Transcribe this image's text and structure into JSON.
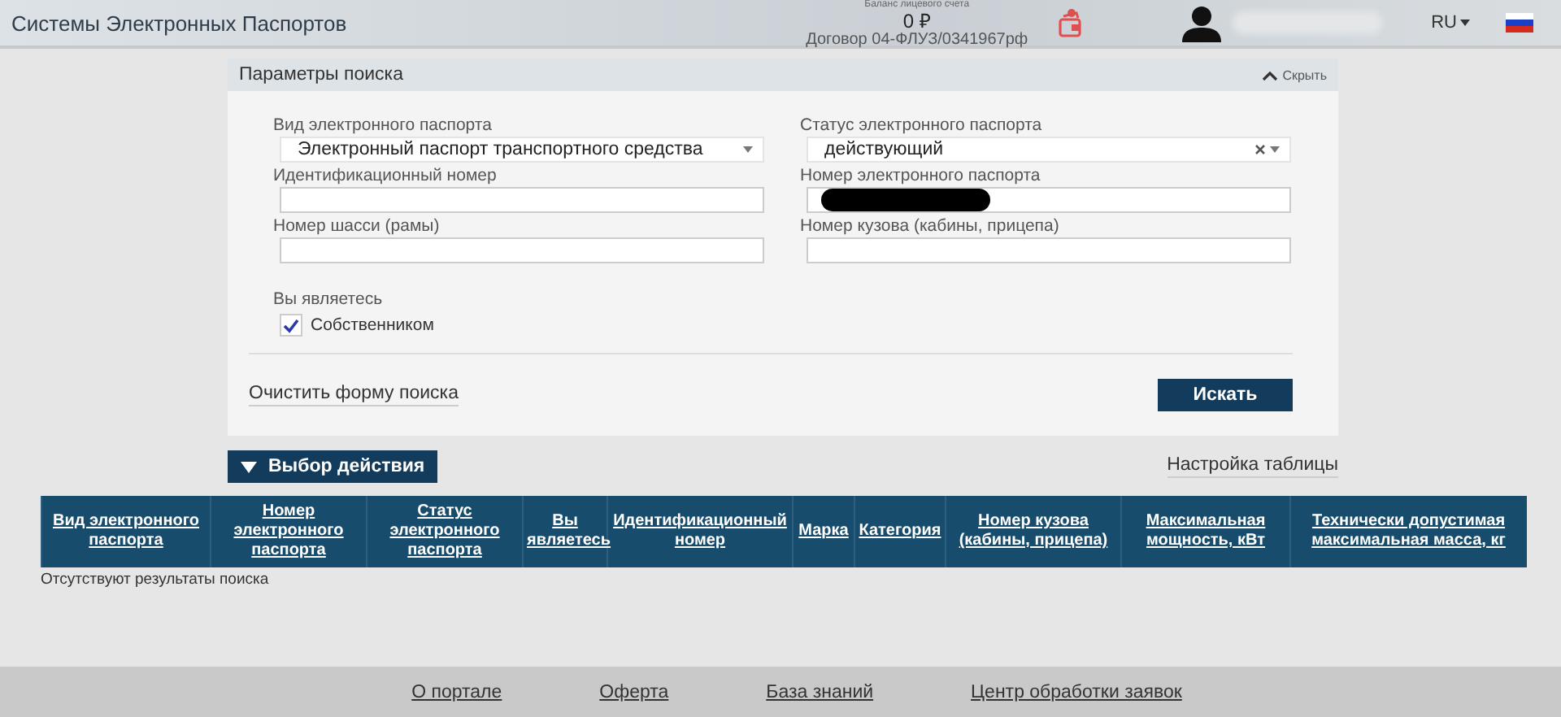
{
  "header": {
    "title": "Системы Электронных Паспортов",
    "balance_label": "Баланс лицевого счета",
    "balance": "0 ₽",
    "contract": "Договор 04-ФЛУЗ/0341967рф",
    "language": "RU"
  },
  "search_panel": {
    "title": "Параметры поиска",
    "collapse_label": "Скрыть",
    "fields": [
      {
        "kind": "select",
        "label": "Вид электронного паспорта",
        "value": "Электронный паспорт транспортного средства",
        "clearable": false
      },
      {
        "kind": "select",
        "label": "Статус электронного паспорта",
        "value": "действующий",
        "clearable": true
      },
      {
        "kind": "text",
        "label": "Идентификационный номер"
      },
      {
        "kind": "redacted",
        "label": "Номер электронного паспорта"
      },
      {
        "kind": "text",
        "label": "Номер шасси (рамы)"
      },
      {
        "kind": "text",
        "label": "Номер кузова (кабины, прицепа)"
      }
    ],
    "owner": {
      "label": "Вы являетесь",
      "option": "Собственником",
      "checked": true
    },
    "clear_link": "Очистить форму поиска",
    "search_button": "Искать"
  },
  "action_button": "Выбор действия",
  "table_settings": "Настройка таблицы",
  "table": {
    "columns": [
      "Вид электронного паспорта",
      "Номер электронного паспорта",
      "Статус электронного паспорта",
      "Вы являетесь",
      "Идентификационный номер",
      "Марка",
      "Категория",
      "Номер кузова (кабины, прицепа)",
      "Максимальная мощность, кВт",
      "Технически допустимая максимальная масса, кг"
    ],
    "empty_message": "Отсутствуют результаты поиска"
  },
  "footer": {
    "links": [
      "О портале",
      "Оферта",
      "База знаний",
      "Центр обработки заявок"
    ]
  }
}
